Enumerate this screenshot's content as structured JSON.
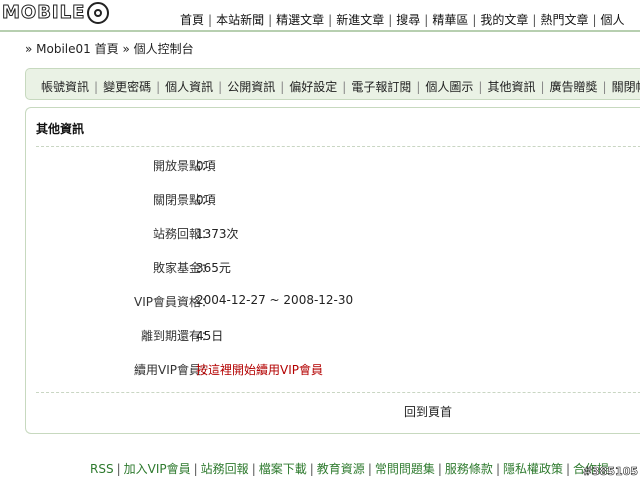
{
  "header": {
    "logo_text": "MOBILE",
    "nav": [
      "首頁",
      "本站新聞",
      "精選文章",
      "新進文章",
      "搜尋",
      "精華區",
      "我的文章",
      "熱門文章",
      "個人"
    ]
  },
  "breadcrumb": {
    "home": "» Mobile01 首頁",
    "current": "» 個人控制台"
  },
  "tabs": [
    "帳號資訊",
    "變更密碼",
    "個人資訊",
    "公開資訊",
    "偏好設定",
    "電子報訂閱",
    "個人圖示",
    "其他資訊",
    "廣告贈獎",
    "關閉帳"
  ],
  "panel": {
    "title": "其他資訊",
    "rows": [
      {
        "label": "開放景點：",
        "value": "0項"
      },
      {
        "label": "關閉景點：",
        "value": "0項"
      },
      {
        "label": "站務回報：",
        "value": "1373次"
      },
      {
        "label": "敗家基金：",
        "value": "365元"
      },
      {
        "label": "VIP會員資格：",
        "value": "2004-12-27 ~ 2008-12-30"
      },
      {
        "label": "離到期還有：",
        "value": "45日"
      },
      {
        "label": "續用VIP會員：",
        "value": "按這裡開始續用VIP會員"
      }
    ],
    "back_label": "回到頁首"
  },
  "footer": {
    "links": [
      "RSS",
      "加入VIP會員",
      "站務回報",
      "檔案下載",
      "教育資源",
      "常問問題集",
      "服務條款",
      "隱私權政策",
      "合作提"
    ]
  },
  "watermark": "#385105",
  "colors": {
    "accent_green": "#2e7a2e",
    "tab_bg": "#eaf2e5",
    "border_green": "#c7d9bf",
    "link_red": "#b30000"
  }
}
